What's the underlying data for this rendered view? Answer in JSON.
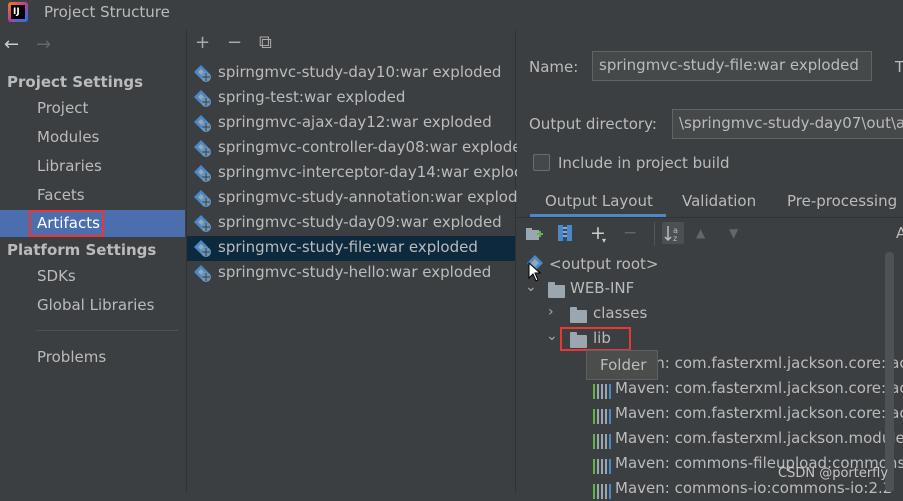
{
  "window": {
    "title": "Project Structure",
    "app_icon_text": "IJ"
  },
  "left_nav": {
    "back_arrow": "←",
    "forward_arrow": "→",
    "project_settings_header": "Project Settings",
    "project_settings_items": [
      "Project",
      "Modules",
      "Libraries",
      "Facets",
      "Artifacts"
    ],
    "platform_settings_header": "Platform Settings",
    "platform_settings_items": [
      "SDKs",
      "Global Libraries"
    ],
    "other_items": [
      "Problems"
    ],
    "selected": "Artifacts"
  },
  "artifacts_toolbar": {
    "add": "+",
    "remove": "−",
    "copy": "⧉"
  },
  "artifacts_list": [
    "spirngmvc-study-day10:war exploded",
    "spring-test:war exploded",
    "springmvc-ajax-day12:war exploded",
    "springmvc-controller-day08:war explode",
    "springmvc-interceptor-day14:war exploc",
    "springmvc-study-annotation:war explode",
    "springmvc-study-day09:war exploded",
    "springmvc-study-file:war exploded",
    "springmvc-study-hello:war exploded"
  ],
  "selected_artifact": "springmvc-study-file:war exploded",
  "details": {
    "name_label": "Name:",
    "name_value": "springmvc-study-file:war exploded",
    "type_label_partial": "T",
    "output_dir_label": "Output directory:",
    "output_dir_value": "\\springmvc-study-day07\\out\\a",
    "include_build_label": "Include in project build",
    "include_build_checked": false,
    "tabs": [
      "Output Layout",
      "Validation",
      "Pre-processing"
    ],
    "active_tab": "Output Layout",
    "right_edge_letter": "A"
  },
  "tree": {
    "root": "<output root>",
    "web_inf": "WEB-INF",
    "classes": "classes",
    "lib": "lib",
    "maven_items": [
      "Maven: com.fasterxml.jackson.core:jac",
      "Maven: com.fasterxml.jackson.core:jac",
      "Maven: com.fasterxml.jackson.core:jac",
      "Maven: com.fasterxml.jackson.module:",
      "Maven: commons-fileupload:commons",
      "Maven: commons-io:commons-io:2.2"
    ]
  },
  "tooltip": "Folder",
  "watermark": "CSDN @porterfly",
  "colors": {
    "selection_blue": "#4b6eaf",
    "list_selection": "#0d293e",
    "highlight_red": "#e53935",
    "tab_underline": "#4a88c7"
  }
}
